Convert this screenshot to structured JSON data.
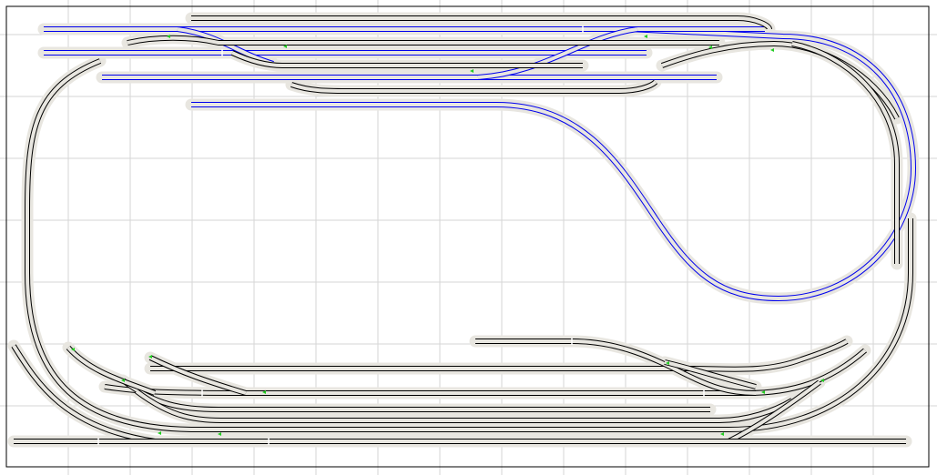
{
  "colors": {
    "background": "#ffffff",
    "grid": "#d6d6d6",
    "frame": "#000000",
    "trackbed": "#e8e6e0",
    "rail_default": "#000000",
    "rail_selected": "#0000ee",
    "sleeper_default": "#ffffff",
    "joint": "#ffffff",
    "turnout_marker": "#22cc22"
  },
  "tracks": [
    {
      "name": "outer-loop",
      "selected": false
    },
    {
      "name": "inner-loop-selected",
      "selected": true
    },
    {
      "name": "upper-yard-track-1-selected",
      "selected": true
    },
    {
      "name": "upper-yard-track-2-selected",
      "selected": true
    },
    {
      "name": "upper-yard-track-3-selected",
      "selected": true
    },
    {
      "name": "upper-yard-crossover-selected",
      "selected": true
    },
    {
      "name": "upper-yard-crossover-b",
      "selected": false
    },
    {
      "name": "upper-yard-loop",
      "selected": false
    },
    {
      "name": "upper-right-branch",
      "selected": false
    },
    {
      "name": "lower-yard-track-1",
      "selected": false
    },
    {
      "name": "lower-yard-track-2",
      "selected": false
    },
    {
      "name": "lower-yard-track-3",
      "selected": false
    },
    {
      "name": "lower-yard-track-4",
      "selected": false
    },
    {
      "name": "lower-siding",
      "selected": false
    },
    {
      "name": "lower-left-ladder",
      "selected": false
    },
    {
      "name": "lower-right-ladder",
      "selected": false
    },
    {
      "name": "bottom-straight",
      "selected": false
    }
  ]
}
